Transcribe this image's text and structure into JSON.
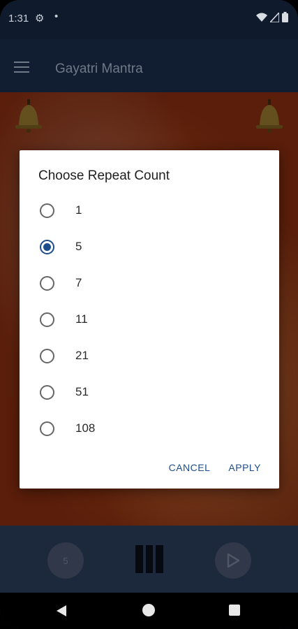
{
  "status_bar": {
    "time": "1:31",
    "notif_dot": "•"
  },
  "app_bar": {
    "title": "Gayatri Mantra"
  },
  "dialog": {
    "title": "Choose Repeat Count",
    "options": [
      {
        "label": "1",
        "checked": false
      },
      {
        "label": "5",
        "checked": true
      },
      {
        "label": "7",
        "checked": false
      },
      {
        "label": "11",
        "checked": false
      },
      {
        "label": "21",
        "checked": false
      },
      {
        "label": "51",
        "checked": false
      },
      {
        "label": "108",
        "checked": false
      }
    ],
    "cancel_label": "CANCEL",
    "apply_label": "APPLY"
  },
  "controls": {
    "count_value": "5"
  },
  "colors": {
    "accent": "#1e4d8c",
    "app_bar": "#111d31"
  },
  "icons": [
    "gear-icon",
    "wifi-icon",
    "signal-icon",
    "battery-icon",
    "menu-icon",
    "bell-icon",
    "pause-bars-icon",
    "play-icon",
    "back-icon",
    "home-icon",
    "recents-icon"
  ]
}
